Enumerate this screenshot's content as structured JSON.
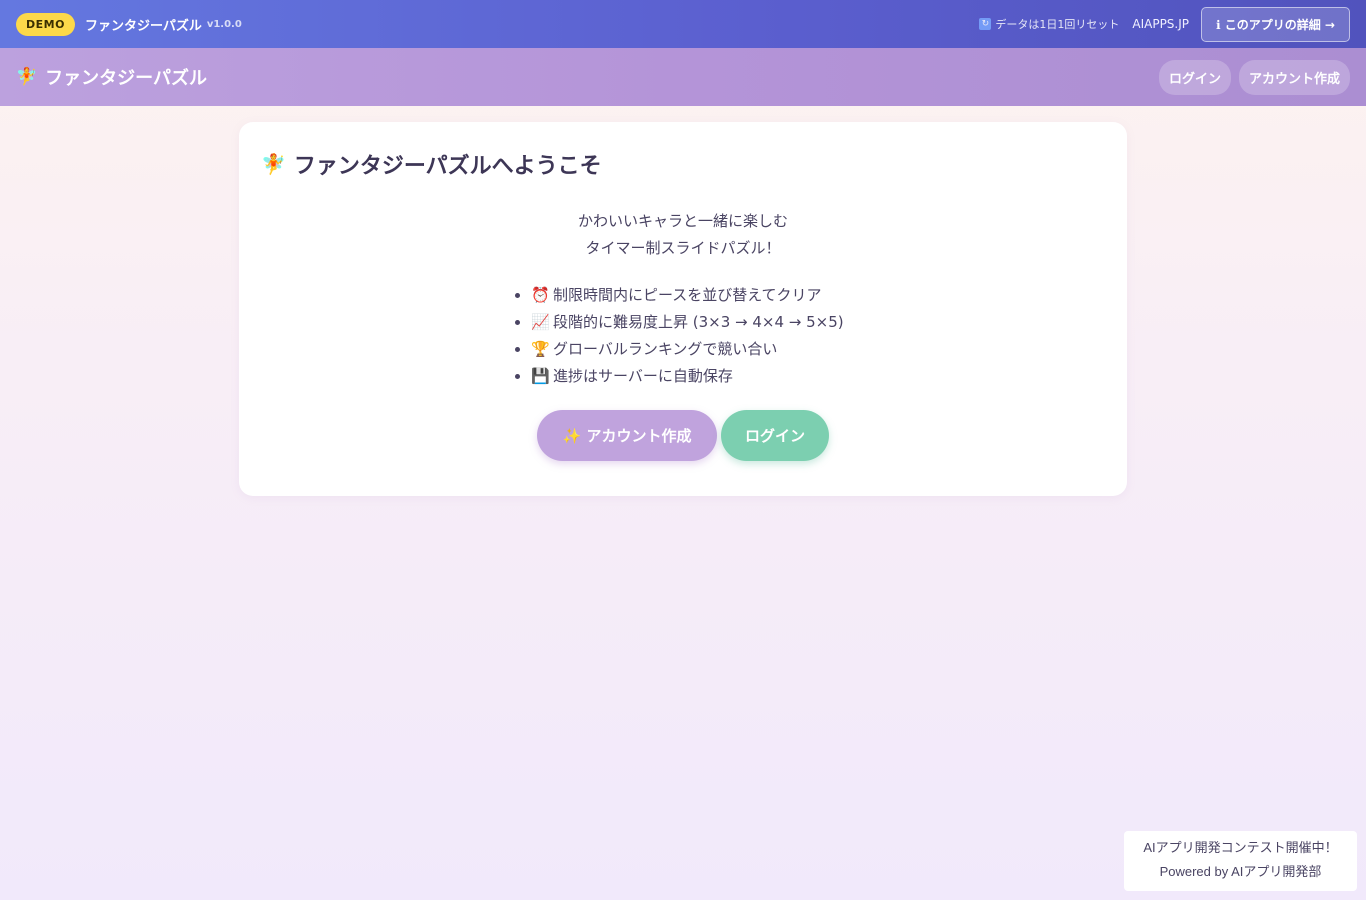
{
  "demo_bar": {
    "badge": "DEMO",
    "app_name": "ファンタジーパズル",
    "version": "v1.0.0",
    "reset_note": "データは1日1回リセット",
    "site_link": "AIAPPS.JP",
    "detail_button": "ℹ このアプリの詳細 →"
  },
  "header": {
    "brand": "ファンタジーパズル",
    "login": "ログイン",
    "signup": "アカウント作成"
  },
  "welcome": {
    "title": "ファンタジーパズルへようこそ",
    "lead_line1": "かわいいキャラと一緒に楽しむ",
    "lead_line2": "タイマー制スライドパズル！",
    "features": [
      {
        "icon": "⏰",
        "text": "制限時間内にピースを並び替えてクリア"
      },
      {
        "icon": "📈",
        "text": "段階的に難易度上昇 (3×3 → 4×4 → 5×5)"
      },
      {
        "icon": "🏆",
        "text": "グローバルランキングで競い合い"
      },
      {
        "icon": "💾",
        "text": "進捗はサーバーに自動保存"
      }
    ],
    "create_button": "✨ アカウント作成",
    "login_button": "ログイン"
  },
  "contest": {
    "line1": "AIアプリ開発コンテスト開催中！",
    "line2": "Powered by AIアプリ開発部"
  },
  "icons": {
    "fairy": "🧚",
    "reset": "🔄"
  },
  "colors": {
    "demo_bar": "#5b5fcf",
    "header": "#b494d8",
    "create_button": "#c0a3dd",
    "login_button": "#7ccfb0",
    "badge": "#fcd94a"
  }
}
